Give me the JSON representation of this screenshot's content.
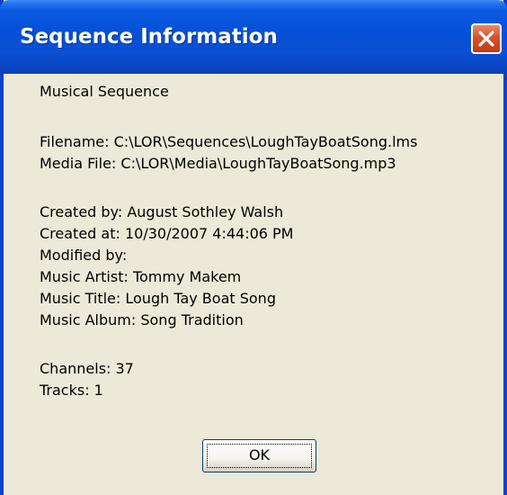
{
  "window": {
    "title": "Sequence Information",
    "close_label": "close"
  },
  "info": {
    "type": "Musical Sequence",
    "filename": "Filename: C:\\LOR\\Sequences\\LoughTayBoatSong.lms",
    "media_file": "Media File: C:\\LOR\\Media\\LoughTayBoatSong.mp3",
    "created_by": "Created by: August Sothley Walsh",
    "created_at": "Created at: 10/30/2007 4:44:06 PM",
    "modified_by": "Modified by:",
    "music_artist": "Music Artist: Tommy Makem",
    "music_title": "Music Title: Lough Tay Boat Song",
    "music_album": "Music Album: Song Tradition",
    "channels": "Channels: 37",
    "tracks": "Tracks: 1"
  },
  "buttons": {
    "ok": "OK"
  },
  "colors": {
    "titlebar": "#0551d8",
    "close": "#d8502a",
    "dialog_background": "#ece9d8"
  },
  "icons": {
    "close": "close-x-icon"
  }
}
